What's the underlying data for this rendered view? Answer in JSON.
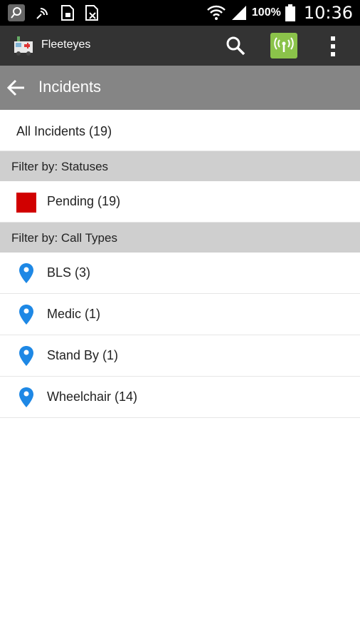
{
  "status_bar": {
    "battery_percent": "100%",
    "time": "10:36"
  },
  "app_bar": {
    "app_name": "Fleeteyes",
    "signal_color": "#8bc34a"
  },
  "title_bar": {
    "title": "Incidents"
  },
  "all_incidents": {
    "label": "All Incidents (19)"
  },
  "statuses": {
    "header": "Filter by: Statuses",
    "items": [
      {
        "label": "Pending (19)",
        "color": "#d10000"
      }
    ]
  },
  "call_types": {
    "header": "Filter by: Call Types",
    "pin_color": "#1e88e5",
    "items": [
      {
        "label": "BLS (3)"
      },
      {
        "label": "Medic (1)"
      },
      {
        "label": "Stand By (1)"
      },
      {
        "label": "Wheelchair (14)"
      }
    ]
  }
}
